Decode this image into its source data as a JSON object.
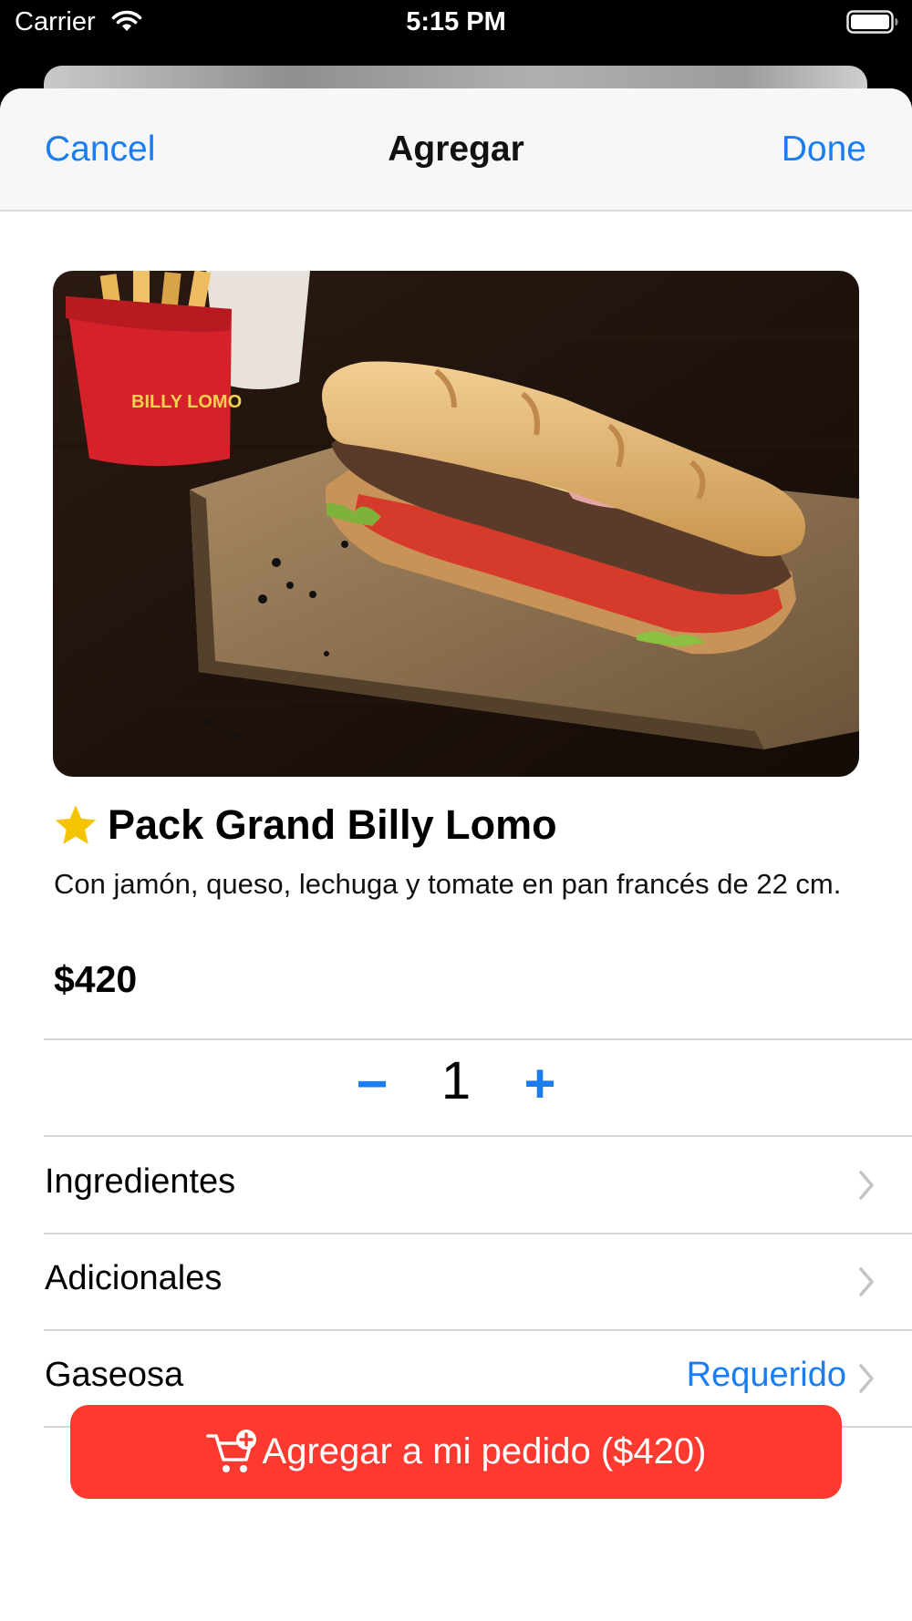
{
  "status_bar": {
    "carrier": "Carrier",
    "time": "5:15 PM",
    "wifi_icon": "wifi-icon",
    "battery_icon": "battery-full-icon"
  },
  "nav": {
    "cancel": "Cancel",
    "title": "Agregar",
    "done": "Done"
  },
  "product": {
    "image_icon": "sandwich-photo",
    "badge_icon": "star-icon",
    "title": "Pack Grand Billy Lomo",
    "description": "Con jamón, queso, lechuga y tomate en pan francés de 22 cm.",
    "price": "$420"
  },
  "stepper": {
    "minus": "−",
    "quantity": "1",
    "plus": "+"
  },
  "options": [
    {
      "label": "Ingredientes",
      "value": ""
    },
    {
      "label": "Adicionales",
      "value": ""
    },
    {
      "label": "Gaseosa",
      "value": "Requerido"
    }
  ],
  "cta": {
    "icon": "cart-add-icon",
    "label": "Agregar a mi pedido ($420)"
  },
  "colors": {
    "accent": "#1a7ef0",
    "cta": "#fe3a30",
    "star": "#f5c400"
  }
}
